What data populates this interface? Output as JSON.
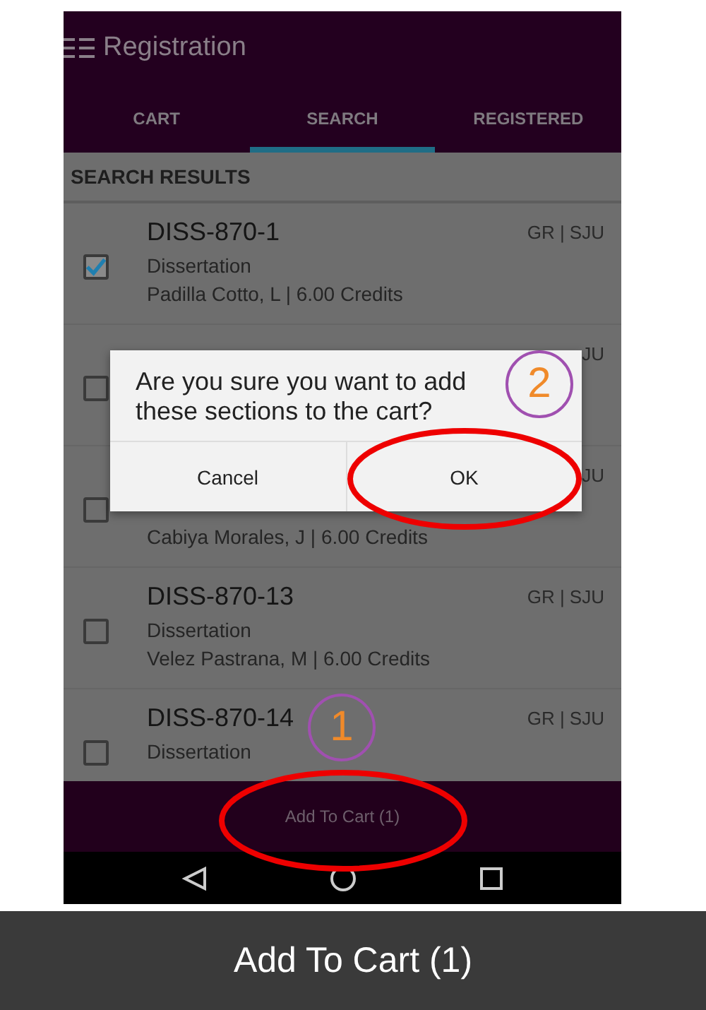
{
  "app_bar": {
    "title": "Registration"
  },
  "tabs": [
    {
      "label": "CART",
      "selected": false
    },
    {
      "label": "SEARCH",
      "selected": true
    },
    {
      "label": "REGISTERED",
      "selected": false
    }
  ],
  "section_header": "SEARCH RESULTS",
  "results": [
    {
      "code": "DISS-870-1",
      "campus": "GR | SJU",
      "type": "Dissertation",
      "details": "Padilla Cotto, L | 6.00 Credits",
      "checked": true
    },
    {
      "campus": "JU",
      "checked": false
    },
    {
      "campus": "JU",
      "details": "Cabiya Morales, J | 6.00 Credits",
      "checked": false
    },
    {
      "code": "DISS-870-13",
      "campus": "GR | SJU",
      "type": "Dissertation",
      "details": "Velez Pastrana, M | 6.00 Credits",
      "checked": false
    },
    {
      "code": "DISS-870-14",
      "campus": "GR | SJU",
      "type": "Dissertation",
      "checked": false
    }
  ],
  "bottom_button": "Add To Cart (1)",
  "dialog": {
    "message": "Are you sure you want to add these sections to the cart?",
    "buttons": [
      "Cancel",
      "OK"
    ]
  },
  "annotations": [
    {
      "label": "2"
    },
    {
      "label": "1"
    }
  ],
  "zoomed_button": "Add To Cart (1)"
}
